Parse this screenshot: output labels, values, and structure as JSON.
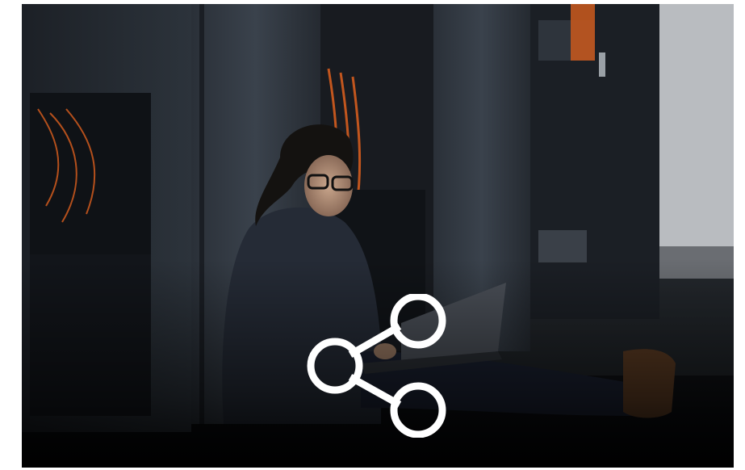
{
  "photo": {
    "subject": "person-with-laptop-in-server-room",
    "icon": "share-icon"
  },
  "colors": {
    "icon": "#ffffff",
    "background_dark": "#0c0e12",
    "cable_orange": "#c2561e"
  }
}
